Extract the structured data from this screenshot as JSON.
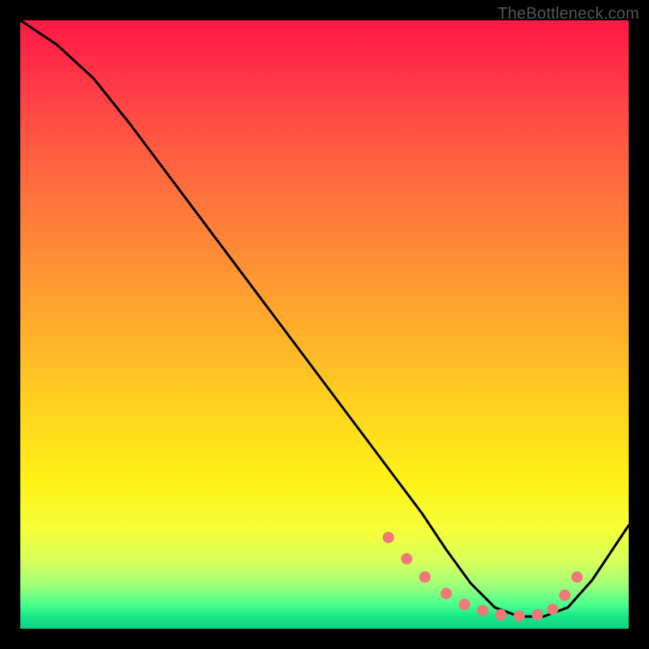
{
  "watermark": "TheBottleneck.com",
  "chart_data": {
    "type": "line",
    "title": "",
    "xlabel": "",
    "ylabel": "",
    "xlim": [
      0,
      100
    ],
    "ylim": [
      0,
      100
    ],
    "series": [
      {
        "name": "curve",
        "x": [
          0,
          6,
          12,
          18,
          24,
          30,
          36,
          42,
          48,
          54,
          60,
          66,
          70,
          74,
          78,
          82,
          86,
          90,
          94,
          100
        ],
        "y": [
          100,
          96,
          90.5,
          83,
          75,
          67,
          59,
          51,
          43,
          35,
          27,
          19,
          13,
          7.5,
          3.5,
          2,
          2,
          3.5,
          8,
          17
        ]
      }
    ],
    "markers": {
      "name": "dots",
      "color": "#f07878",
      "x": [
        60.5,
        63.5,
        66.5,
        70,
        73,
        76,
        79,
        82,
        85,
        87.5,
        89.5,
        91.5
      ],
      "y": [
        15,
        11.5,
        8.5,
        5.8,
        4,
        3,
        2.3,
        2.1,
        2.3,
        3.2,
        5.5,
        8.5
      ]
    }
  }
}
